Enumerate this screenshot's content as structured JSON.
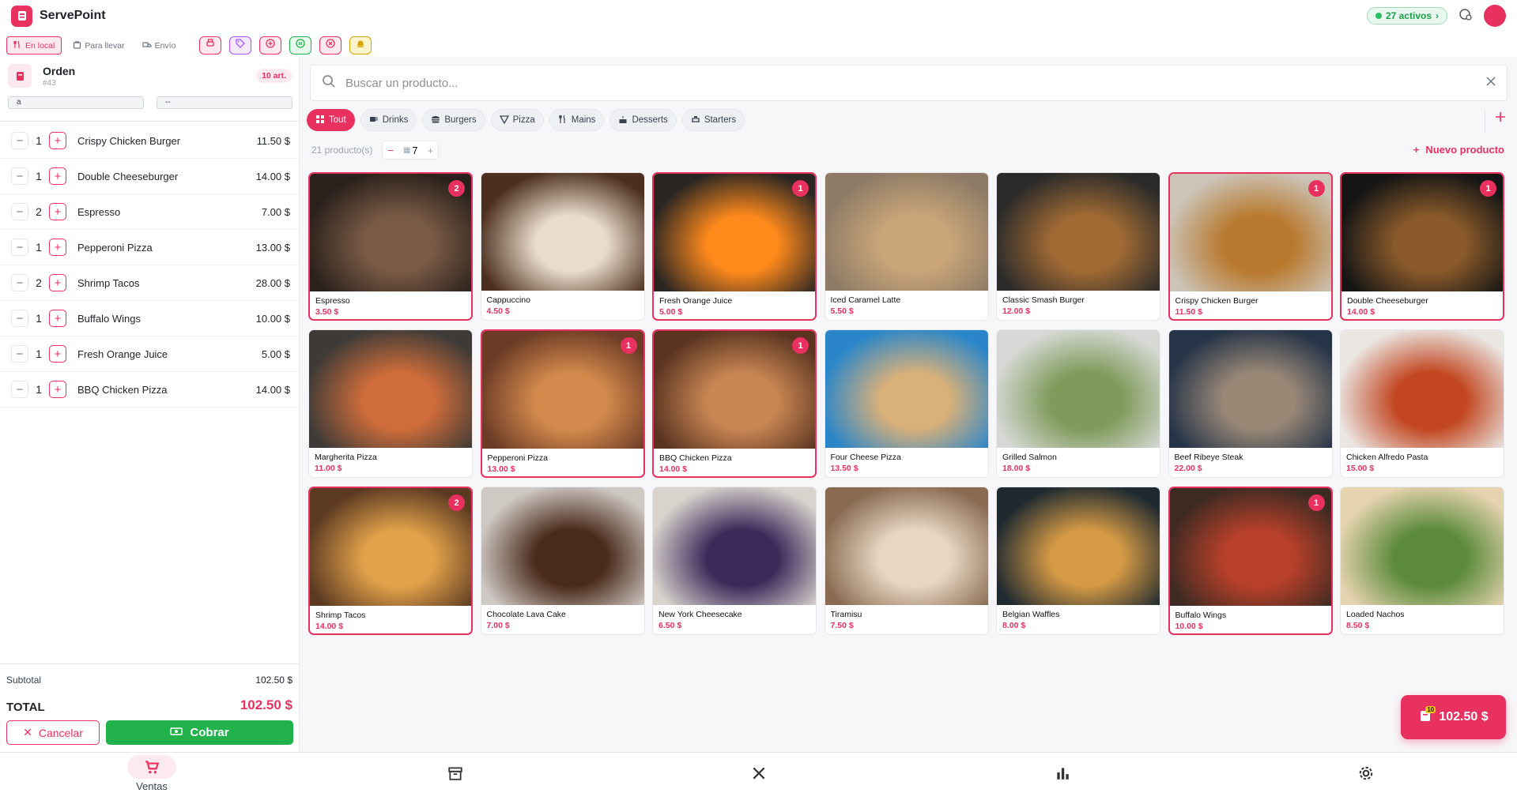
{
  "app": {
    "title": "ServePoint",
    "active_label": "27 activos"
  },
  "modes": [
    {
      "label": "En local",
      "icon": "utensils-icon"
    },
    {
      "label": "Para llevar",
      "icon": "bag-icon"
    },
    {
      "label": "Envío",
      "icon": "truck-icon"
    }
  ],
  "toolbar_icons": [
    {
      "name": "print-icon",
      "color": "#e8315f",
      "bg": "#fdeaf0"
    },
    {
      "name": "tag-icon",
      "color": "#a855f7",
      "bg": "#f5e9fe"
    },
    {
      "name": "plus-circle-icon",
      "color": "#e8315f",
      "bg": "#fdeaf0"
    },
    {
      "name": "pause-circle-icon",
      "color": "#22b24c",
      "bg": "#e7f8ec"
    },
    {
      "name": "x-circle-icon",
      "color": "#e8315f",
      "bg": "#fdeaf0"
    },
    {
      "name": "bell-icon",
      "color": "#d9a400",
      "bg": "#fff5cc"
    }
  ],
  "order": {
    "title": "Orden",
    "number": "#43",
    "count": "10 art.",
    "field1": "a",
    "field2": "--",
    "lines": [
      {
        "qty": "1",
        "name": "Crispy Chicken Burger",
        "price": "11.50 $"
      },
      {
        "qty": "1",
        "name": "Double Cheeseburger",
        "price": "14.00 $"
      },
      {
        "qty": "2",
        "name": "Espresso",
        "price": "7.00 $"
      },
      {
        "qty": "1",
        "name": "Pepperoni Pizza",
        "price": "13.00 $"
      },
      {
        "qty": "2",
        "name": "Shrimp Tacos",
        "price": "28.00 $"
      },
      {
        "qty": "1",
        "name": "Buffalo Wings",
        "price": "10.00 $"
      },
      {
        "qty": "1",
        "name": "Fresh Orange Juice",
        "price": "5.00 $"
      },
      {
        "qty": "1",
        "name": "BBQ Chicken Pizza",
        "price": "14.00 $"
      }
    ],
    "subtotal_label": "Subtotal",
    "subtotal": "102.50 $",
    "total_label": "TOTAL",
    "total": "102.50 $",
    "cancel_label": "Cancelar",
    "pay_label": "Cobrar"
  },
  "search": {
    "placeholder": "Buscar un producto..."
  },
  "categories": [
    {
      "label": "Tout",
      "icon": "grid-icon",
      "active": true
    },
    {
      "label": "Drinks",
      "icon": "cup-icon"
    },
    {
      "label": "Burgers",
      "icon": "burger-icon"
    },
    {
      "label": "Pizza",
      "icon": "pizza-icon"
    },
    {
      "label": "Mains",
      "icon": "utensils-icon"
    },
    {
      "label": "Desserts",
      "icon": "cake-icon"
    },
    {
      "label": "Starters",
      "icon": "starter-icon"
    }
  ],
  "products_info": {
    "count_label": "21 producto(s)",
    "columns": "7",
    "new_label": "Nuevo producto"
  },
  "products": [
    {
      "name": "Espresso",
      "price": "3.50 $",
      "qty": "2",
      "c1": "#2a211c",
      "c2": "#7a5a45"
    },
    {
      "name": "Cappuccino",
      "price": "4.50 $",
      "qty": "",
      "c1": "#4d2f1f",
      "c2": "#e9dccb"
    },
    {
      "name": "Fresh Orange Juice",
      "price": "5.00 $",
      "qty": "1",
      "c1": "#2b2622",
      "c2": "#ff8a1c"
    },
    {
      "name": "Iced Caramel Latte",
      "price": "5.50 $",
      "qty": "",
      "c1": "#8e7b66",
      "c2": "#c9a579"
    },
    {
      "name": "Classic Smash Burger",
      "price": "12.00 $",
      "qty": "",
      "c1": "#2a2a2a",
      "c2": "#a06a34"
    },
    {
      "name": "Crispy Chicken Burger",
      "price": "11.50 $",
      "qty": "1",
      "c1": "#ccc4b8",
      "c2": "#b8792e"
    },
    {
      "name": "Double Cheeseburger",
      "price": "14.00 $",
      "qty": "1",
      "c1": "#151515",
      "c2": "#8a5a2a"
    },
    {
      "name": "Margherita Pizza",
      "price": "11.00 $",
      "qty": "",
      "c1": "#3d3a37",
      "c2": "#cf6d3a"
    },
    {
      "name": "Pepperoni Pizza",
      "price": "13.00 $",
      "qty": "1",
      "c1": "#6b3b26",
      "c2": "#d48a4c"
    },
    {
      "name": "BBQ Chicken Pizza",
      "price": "14.00 $",
      "qty": "1",
      "c1": "#5a3421",
      "c2": "#c88652"
    },
    {
      "name": "Four Cheese Pizza",
      "price": "13.50 $",
      "qty": "",
      "c1": "#2a86c9",
      "c2": "#d7b07a"
    },
    {
      "name": "Grilled Salmon",
      "price": "18.00 $",
      "qty": "",
      "c1": "#d7d9d6",
      "c2": "#7f9a5a"
    },
    {
      "name": "Beef Ribeye Steak",
      "price": "22.00 $",
      "qty": "",
      "c1": "#263448",
      "c2": "#9a8877"
    },
    {
      "name": "Chicken Alfredo Pasta",
      "price": "15.00 $",
      "qty": "",
      "c1": "#eae6e2",
      "c2": "#c24620"
    },
    {
      "name": "Shrimp Tacos",
      "price": "14.00 $",
      "qty": "2",
      "c1": "#5c3a22",
      "c2": "#e2a24a"
    },
    {
      "name": "Chocolate Lava Cake",
      "price": "7.00 $",
      "qty": "",
      "c1": "#cfc9c4",
      "c2": "#4a2a1a"
    },
    {
      "name": "New York Cheesecake",
      "price": "6.50 $",
      "qty": "",
      "c1": "#d8d3cd",
      "c2": "#3b2a5a"
    },
    {
      "name": "Tiramisu",
      "price": "7.50 $",
      "qty": "",
      "c1": "#8a6b52",
      "c2": "#e7d7c2"
    },
    {
      "name": "Belgian Waffles",
      "price": "8.00 $",
      "qty": "",
      "c1": "#1f2a30",
      "c2": "#d59a45"
    },
    {
      "name": "Buffalo Wings",
      "price": "10.00 $",
      "qty": "1",
      "c1": "#3d2a22",
      "c2": "#b8402a"
    },
    {
      "name": "Loaded Nachos",
      "price": "8.50 $",
      "qty": "",
      "c1": "#e6d3b0",
      "c2": "#5a8a3a"
    }
  ],
  "fab": {
    "label": "102.50 $",
    "badge": "10"
  },
  "nav": [
    {
      "label": "Ventas",
      "icon": "cart-icon",
      "active": true
    },
    {
      "label": "",
      "icon": "archive-icon"
    },
    {
      "label": "",
      "icon": "kitchen-icon"
    },
    {
      "label": "",
      "icon": "chart-icon"
    },
    {
      "label": "",
      "icon": "gear-icon"
    }
  ]
}
